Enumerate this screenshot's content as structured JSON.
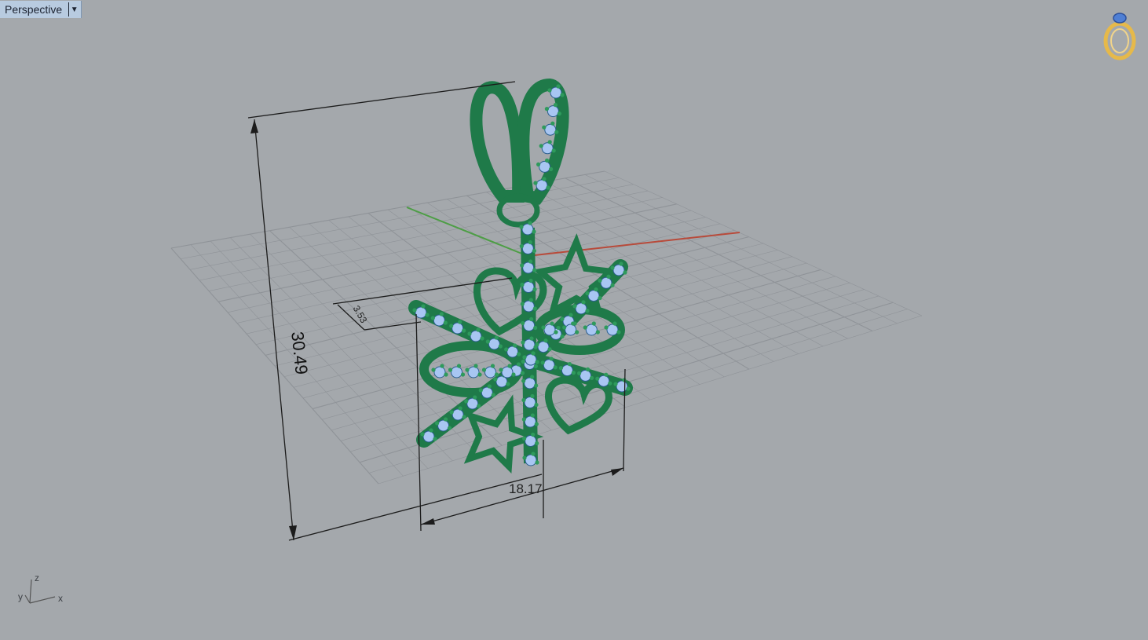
{
  "viewport": {
    "name": "Perspective",
    "dropdown_glyph": "▼"
  },
  "dimensions": {
    "height": "30.49",
    "width": "18.17",
    "depth": "3.53"
  },
  "axis_labels": {
    "x": "x",
    "y": "y",
    "z": "z"
  },
  "colors": {
    "background": "#a4a8ac",
    "grid": "#8f9398",
    "x_axis": "#b84a3a",
    "y_axis": "#4d9e45",
    "metal": "#1f7a49",
    "gem": "#a8c6f2",
    "dimension_line": "#1c1c1c",
    "logo": "#e6b94a"
  },
  "icons": [
    "viewport-menu-arrow-icon",
    "ring-logo-icon",
    "world-axis-icon"
  ]
}
